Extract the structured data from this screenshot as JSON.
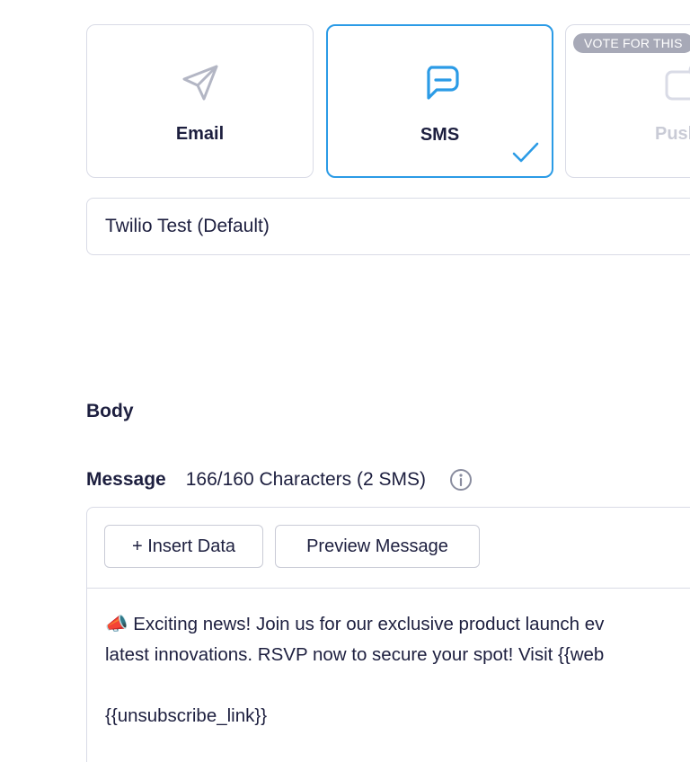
{
  "channels": [
    {
      "label": "Email",
      "icon": "paper-plane-icon",
      "selected": false
    },
    {
      "label": "SMS",
      "icon": "chat-bubble-icon",
      "selected": true
    },
    {
      "label": "Push",
      "icon": "push-notification-icon",
      "selected": false,
      "disabled": true
    }
  ],
  "vote_badge": "VOTE FOR THIS",
  "provider": {
    "value": "Twilio Test (Default)"
  },
  "body_section": {
    "title": "Body"
  },
  "message": {
    "label": "Message",
    "char_count": "166/160 Characters (2 SMS)"
  },
  "toolbar": {
    "insert_label": "+ Insert Data",
    "preview_label": "Preview Message"
  },
  "body": {
    "line1": "📣 Exciting news! Join us for our exclusive product launch ev",
    "line2": "latest innovations. RSVP now to secure your spot! Visit {{web",
    "line3": "",
    "line4": "{{unsubscribe_link}}"
  },
  "colors": {
    "accent": "#2b9be6",
    "text": "#1d1f3f",
    "border": "#d9dbe6",
    "badge": "#a7a9b7"
  }
}
